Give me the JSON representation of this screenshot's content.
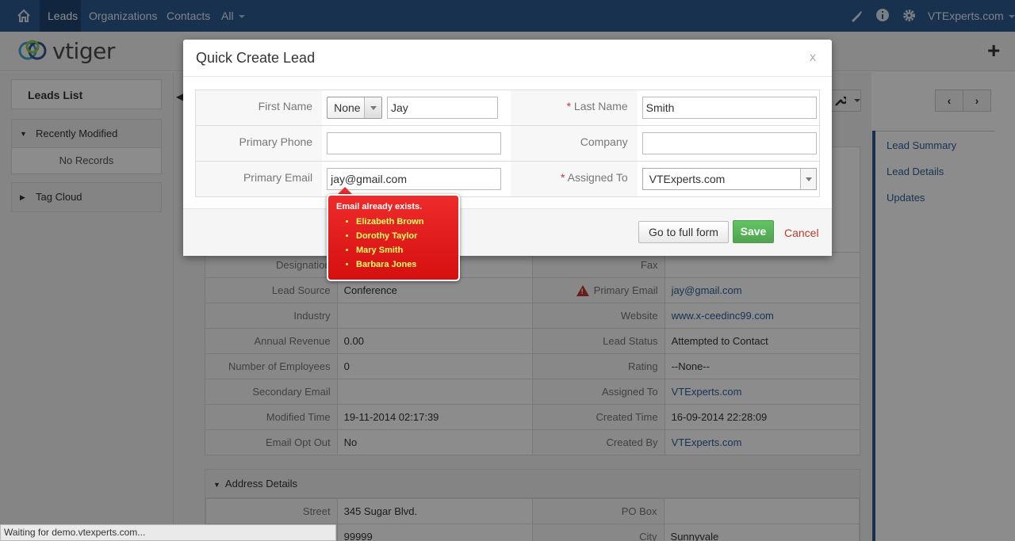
{
  "topnav": {
    "items": [
      "Leads",
      "Organizations",
      "Contacts",
      "All"
    ],
    "user": "VTExperts.com"
  },
  "logo": {
    "text": "vtiger"
  },
  "sidebar": {
    "leads_list": "Leads List",
    "recently_modified": "Recently Modified",
    "no_records": "No Records",
    "tag_cloud": "Tag Cloud"
  },
  "detail": {
    "rows": [
      {
        "l1": "Designation",
        "v1": "",
        "l2": "Fax",
        "v2": ""
      },
      {
        "l1": "Lead Source",
        "v1": "Conference",
        "l2": "Primary Email",
        "v2": "jay@gmail.com"
      },
      {
        "l1": "Industry",
        "v1": "",
        "l2": "Website",
        "v2": "www.x-ceedinc99.com"
      },
      {
        "l1": "Annual Revenue",
        "v1": "0.00",
        "l2": "Lead Status",
        "v2": "Attempted to Contact"
      },
      {
        "l1": "Number of Employees",
        "v1": "0",
        "l2": "Rating",
        "v2": "--None--"
      },
      {
        "l1": "Secondary Email",
        "v1": "",
        "l2": "Assigned To",
        "v2": "VTExperts.com"
      },
      {
        "l1": "Modified Time",
        "v1": "19-11-2014 02:17:39",
        "l2": "Created Time",
        "v2": "16-09-2014 22:28:09"
      },
      {
        "l1": "Email Opt Out",
        "v1": "No",
        "l2": "Created By",
        "v2": "VTExperts.com"
      }
    ],
    "address_header": "Address Details",
    "address_rows": [
      {
        "l1": "Street",
        "v1": "345 Sugar Blvd.",
        "l2": "PO Box",
        "v2": ""
      },
      {
        "l1": "",
        "v1": "99999",
        "l2": "City",
        "v2": "Sunnyvale"
      }
    ]
  },
  "right_nav": [
    "Lead Summary",
    "Lead Details",
    "Updates"
  ],
  "modal": {
    "title": "Quick Create Lead",
    "close": "x",
    "first_name_label": "First Name",
    "salutation": "None",
    "first_name": "Jay",
    "last_name_label": "Last Name",
    "last_name": "Smith",
    "primary_phone_label": "Primary Phone",
    "primary_phone": "",
    "company_label": "Company",
    "company": "",
    "primary_email_label": "Primary Email",
    "primary_email": "jay@gmail.com",
    "assigned_to_label": "Assigned To",
    "assigned_to": "VTExperts.com",
    "required_mark": "*",
    "go_full_form": "Go to full form",
    "save": "Save",
    "cancel": "Cancel"
  },
  "error": {
    "title": "Email already exists.",
    "names": [
      "Elizabeth Brown",
      "Dorothy Taylor",
      "Mary Smith",
      "Barbara Jones"
    ]
  },
  "status": "Waiting for demo.vtexperts.com..."
}
